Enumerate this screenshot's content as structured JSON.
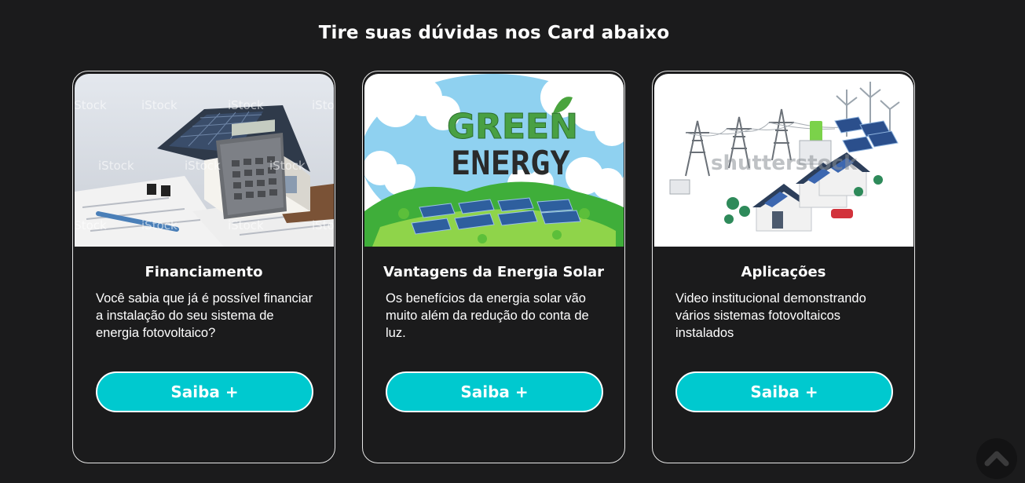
{
  "section": {
    "title": "Tire suas dúvidas nos Card abaixo"
  },
  "cards": [
    {
      "image_icon": "house-calculator-image",
      "watermark": "iStock",
      "title": "Financiamento",
      "text": "Você sabia que já é possível financiar a instalação do seu sistema de energia fotovoltaico?",
      "button_label": "Saiba +"
    },
    {
      "image_icon": "green-energy-image",
      "image_text_line1": "GREEN",
      "image_text_line2": "ENERGY",
      "title": "Vantagens da Energia Solar",
      "text": "Os benefícios da energia solar vão muito além da redução do conta de luz.",
      "button_label": "Saiba +"
    },
    {
      "image_icon": "solar-grid-houses-image",
      "watermark": "shutterstock",
      "title": "Aplicações",
      "text": "Video institucional demonstrando vários sistemas fotovoltaicos instalados",
      "button_label": "Saiba +"
    }
  ],
  "scroll_top": {
    "icon": "chevron-up-icon"
  },
  "colors": {
    "background": "#1b1b1c",
    "button": "#00c9cf",
    "text": "#ffffff",
    "card_border": "#e8e8e8"
  }
}
